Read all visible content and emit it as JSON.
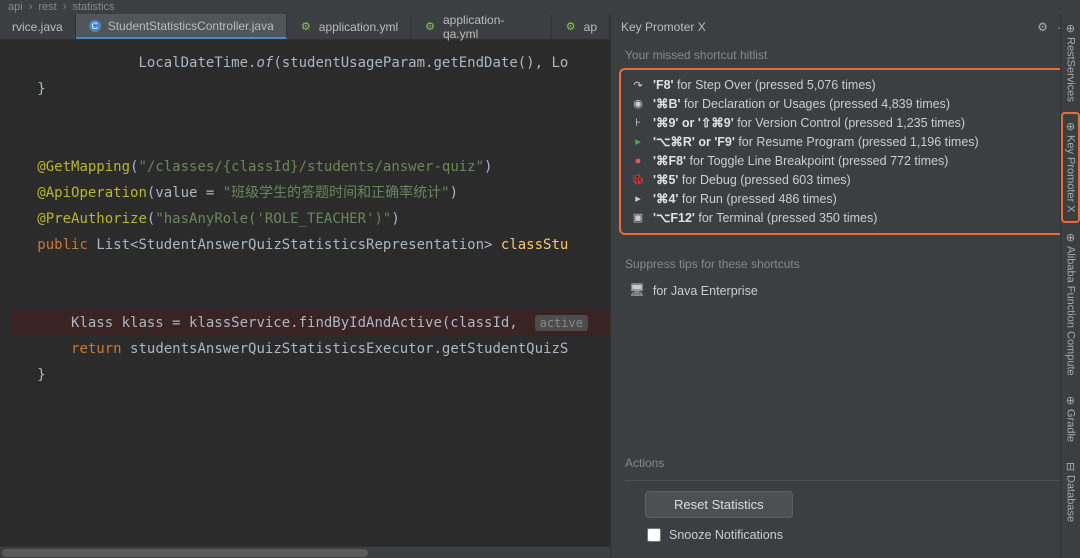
{
  "breadcrumb": {
    "a": "api",
    "b": "rest",
    "c": "statistics"
  },
  "tabs": {
    "t0": "rvice.java",
    "t1": "StudentStatisticsController.java",
    "t2": "application.yml",
    "t3": "application-qa.yml",
    "t4": "ap"
  },
  "code": {
    "l1a": "LocalDateTime.",
    "l1b": "of",
    "l1c": "(studentUsageParam.getEndDate(), Lo",
    "l2": "}",
    "l4a": "@GetMapping",
    "l4b": "(",
    "l4c": "\"/classes/{classId}/students/answer-quiz\"",
    "l4d": ")",
    "l5a": "@ApiOperation",
    "l5b": "(",
    "l5c": "value = ",
    "l5d": "\"班级学生的答题时间和正确率统计\"",
    "l5e": ")",
    "l6a": "@PreAuthorize",
    "l6b": "(",
    "l6c": "\"hasAnyRole('ROLE_TEACHER')\"",
    "l6d": ")",
    "l7a": "public ",
    "l7b": "List<StudentAnswerQuizStatisticsRepresentation> ",
    "l7c": "classStu",
    "l9a": "Klass klass = klassService.findByIdAndActive(classId, ",
    "l9hint": "active",
    "l9b": "",
    "l10a": "return ",
    "l10b": "studentsAnswerQuizStatisticsExecutor",
    "l10c": ".getStudentQuizS",
    "l11": "}"
  },
  "tool": {
    "title": "Key Promoter X",
    "section_hitlist": "Your missed shortcut hitlist",
    "section_suppress": "Suppress tips for these shortcuts",
    "section_actions": "Actions",
    "reset_btn": "Reset Statistics",
    "snooze_label": "Snooze Notifications",
    "suppress_item": "for Java Enterprise"
  },
  "hits": {
    "h0k": "'F8'",
    "h0d": " for Step Over (pressed 5,076 times)",
    "h1k": "'⌘B'",
    "h1d": " for Declaration or Usages (pressed 4,839 times)",
    "h2k": "'⌘9' or '⇧⌘9'",
    "h2d": " for Version Control (pressed 1,235 times)",
    "h3k": "'⌥⌘R' or 'F9'",
    "h3d": " for Resume Program (pressed 1,196 times)",
    "h4k": "'⌘F8'",
    "h4d": " for Toggle Line Breakpoint (pressed 772 times)",
    "h5k": "'⌘5'",
    "h5d": " for Debug (pressed 603 times)",
    "h6k": "'⌘4'",
    "h6d": " for Run (pressed 486 times)",
    "h7k": "'⌥F12'",
    "h7d": " for Terminal (pressed 350 times)"
  },
  "rightbar": {
    "r0": "RestServices",
    "r1": "Key Promoter X",
    "r2": "Alibaba Function Compute",
    "r3": "Gradle",
    "r4": "Database"
  }
}
